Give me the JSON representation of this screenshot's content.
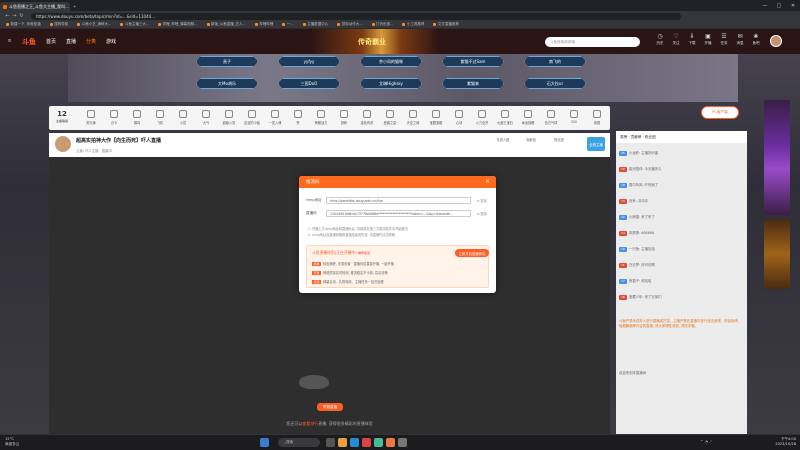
{
  "browser": {
    "tabs": [
      {
        "title": "斗鱼直播之王_斗鱼大主播_我叫..."
      }
    ],
    "url": "https://www.douyu.com/beta/topic/min?id=...&rid=11044...",
    "bookmarks": [
      "新建一下, 你就知道",
      "搜狗导航",
      "斗鱼小艺_海峡大...",
      "斗鱼主播三大...",
      "哔哩_哔哩_弹幕视频...",
      "新版_斗鱼直播_艺人...",
      "哔哩哔哩",
      "一...",
      "主播数据中心",
      "鼠标动作大...",
      "打折优惠...",
      "小工具推荐",
      "文字直播推荐"
    ],
    "window_controls": [
      "—",
      "□",
      "✕"
    ]
  },
  "site": {
    "logo": "斗鱼",
    "nav": [
      "首页",
      "直播",
      "分类",
      "游戏"
    ],
    "banner_text": "传奇霸业",
    "search_placeholder": "斗鱼搜索新鲜事",
    "header_icons": [
      {
        "icon": "history-icon",
        "label": "历史"
      },
      {
        "icon": "follow-icon",
        "label": "关注"
      },
      {
        "icon": "download-icon",
        "label": "下载"
      },
      {
        "icon": "broadcast-icon",
        "label": "开播"
      },
      {
        "icon": "task-icon",
        "label": "任务"
      },
      {
        "icon": "message-icon",
        "label": "消息"
      },
      {
        "icon": "gift-icon",
        "label": "鱼吧"
      }
    ]
  },
  "hero": {
    "row1": [
      "责子",
      "yyfyy",
      "余小凤的猫咪",
      "紫猫不过Sam",
      "南飞的"
    ],
    "row2": [
      "大Mo胡乐",
      "三国DoO",
      "艾琳Highsky",
      "紫猫来",
      "石大拉ur"
    ]
  },
  "giftbar": {
    "count": "12",
    "count_label": "主播等级",
    "items": [
      "荧光棒",
      "办卡",
      "弱鸡",
      "飞机",
      "火箭",
      "大气",
      "超级火箭",
      "友谊的小船",
      "一发入魂",
      "赞",
      "荣耀战力",
      "铁粉",
      "金色传说",
      "盛典之星",
      "天空之城",
      "宝藏宝箱",
      "心动",
      "火力全开",
      "大魔王宝石",
      "幸运锦鲤",
      "告白气球",
      "520",
      "鱼翅",
      "鱼丸"
    ],
    "pc_badge": "PC客户端"
  },
  "stream": {
    "title": "超高实拍神大作【向生而死】吓人直播",
    "host": "主播: 吓人主播 · 直播中",
    "tag": "主机游戏",
    "follow": "关注",
    "stats": [
      "在线人数",
      "贡献值",
      "粉丝团"
    ],
    "badge": "全勤主播",
    "offline_text_pre": "您还可以",
    "offline_link": "查看排行",
    "offline_text_post": "直播, 获得很多精彩的直播体验",
    "report_button": "举报直播"
  },
  "modal": {
    "title": "推流码",
    "close": "×",
    "rtmp_label": "rtmp地址",
    "rtmp_value": "rtmp://sendfdrs.douyucdn.cn/live",
    "key_label": "直播码",
    "key_value": "11044941fa8cdc73778a0d8fa********************?token=...&isp=&wsAuth...",
    "copy_label": "复制",
    "note1": "1. 开播上方rtmp地址和直播码后, 将其填至第三方推流软件中开始推流",
    "note2": "2. rtmp地址及直播码随着直播结束而失效, 请直播时点击获取",
    "obs_title": "斗鱼直播伴侣(正在开播中)",
    "obs_badge": "推荐使用",
    "obs_button": "立即开启直播伴侣",
    "obs_lines": [
      {
        "tag": "简单",
        "text": "轻松捕获, 无需设置 · 直播伴侣直接开播, 一键开播"
      },
      {
        "tag": "可靠",
        "text": "网络质量实时检测, 推流稳定不卡顿, 高清流畅"
      },
      {
        "tag": "实用",
        "text": "弹幕互动、礼物特效、主播任务一站式处理"
      }
    ]
  },
  "chat": {
    "header": "周榜 · 贡献榜 · 粉丝团",
    "messages": [
      {
        "badge": "25",
        "user": "小龙虾",
        "text": "主播好厉害"
      },
      {
        "badge": "10",
        "user": "星光陪伴",
        "text": "今天播多久"
      },
      {
        "badge": "18",
        "user": "雪中听风",
        "text": "吓死我了"
      },
      {
        "badge": "13",
        "user": "剑来",
        "text": "冲冲冲"
      },
      {
        "badge": "12",
        "user": "小熊猫",
        "text": "来了来了"
      },
      {
        "badge": "14",
        "user": "风萧萧",
        "text": "666666"
      },
      {
        "badge": "19",
        "user": "一只鱼",
        "text": "主播加油"
      },
      {
        "badge": "11",
        "user": "白日梦",
        "text": "好可怕啊"
      },
      {
        "badge": "17",
        "user": "夜猫子",
        "text": "哈哈哈"
      },
      {
        "badge": "16",
        "user": "宝藏少年",
        "text": "来了兄弟们"
      }
    ],
    "notice": "斗鱼严禁未成年人进行直播或打赏。主播严禁在直播中进行违法违规、低俗色情、吸烟酗酒等内容的直播, 请大家理性消费, 谨防诈骗。",
    "welcome": "欢迎来到本直播间"
  },
  "taskbar": {
    "weather_temp": "15°C",
    "weather_desc": "局部多云",
    "search": "搜索",
    "time": "下午4:00",
    "date": "2023/10/28"
  }
}
